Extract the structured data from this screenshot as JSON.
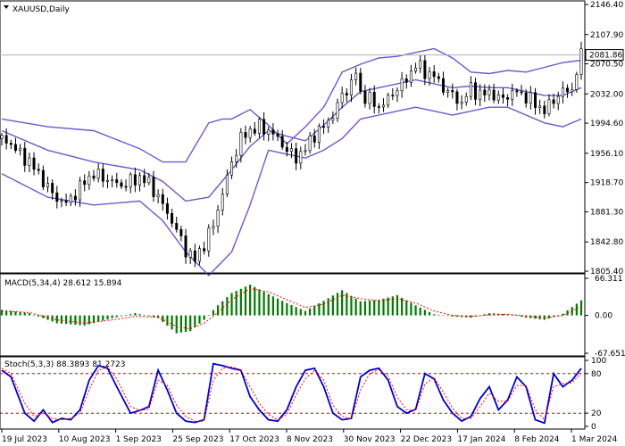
{
  "window": {
    "title": "XAUUSD,Daily",
    "menu_icon": "triangle-down-icon"
  },
  "chart_data": [
    {
      "type": "candlestick",
      "panel": "price",
      "symbol": "XAUUSD",
      "timeframe": "Daily",
      "current_price": "2081.86",
      "y_ticks": [
        "2146.40",
        "2107.90",
        "2070.50",
        "2032.00",
        "1994.60",
        "1956.10",
        "1918.70",
        "1881.30",
        "1842.80",
        "1805.40"
      ],
      "ylim": [
        1805.4,
        2146.4
      ],
      "x_ticks": [
        "19 Jul 2023",
        "10 Aug 2023",
        "1 Sep 2023",
        "25 Sep 2023",
        "17 Oct 2023",
        "8 Nov 2023",
        "30 Nov 2023",
        "22 Dec 2023",
        "17 Jan 2024",
        "8 Feb 2024",
        "1 Mar 2024"
      ],
      "overlay": "Bollinger Bands",
      "close_series": [
        [
          0,
          1975
        ],
        [
          4,
          1968
        ],
        [
          8,
          1955
        ],
        [
          12,
          1945
        ],
        [
          16,
          1930
        ],
        [
          20,
          1912
        ],
        [
          24,
          1898
        ],
        [
          28,
          1892
        ],
        [
          32,
          1905
        ],
        [
          36,
          1920
        ],
        [
          40,
          1930
        ],
        [
          44,
          1925
        ],
        [
          48,
          1920
        ],
        [
          52,
          1915
        ],
        [
          56,
          1920
        ],
        [
          60,
          1925
        ],
        [
          64,
          1918
        ],
        [
          68,
          1900
        ],
        [
          72,
          1880
        ],
        [
          76,
          1858
        ],
        [
          80,
          1832
        ],
        [
          84,
          1820
        ],
        [
          88,
          1840
        ],
        [
          92,
          1865
        ],
        [
          96,
          1905
        ],
        [
          100,
          1945
        ],
        [
          104,
          1975
        ],
        [
          108,
          1985
        ],
        [
          112,
          1990
        ],
        [
          116,
          1985
        ],
        [
          120,
          1975
        ],
        [
          124,
          1960
        ],
        [
          128,
          1950
        ],
        [
          132,
          1962
        ],
        [
          136,
          1980
        ],
        [
          140,
          1990
        ],
        [
          144,
          2005
        ],
        [
          148,
          2030
        ],
        [
          152,
          2045
        ],
        [
          154,
          2060
        ],
        [
          156,
          2032
        ],
        [
          160,
          2025
        ],
        [
          164,
          2015
        ],
        [
          168,
          2025
        ],
        [
          172,
          2040
        ],
        [
          176,
          2050
        ],
        [
          180,
          2070
        ],
        [
          184,
          2060
        ],
        [
          188,
          2055
        ],
        [
          192,
          2040
        ],
        [
          196,
          2030
        ],
        [
          200,
          2020
        ],
        [
          204,
          2040
        ],
        [
          208,
          2030
        ],
        [
          212,
          2035
        ],
        [
          216,
          2025
        ],
        [
          220,
          2030
        ],
        [
          224,
          2035
        ],
        [
          228,
          2028
        ],
        [
          232,
          2020
        ],
        [
          236,
          2010
        ],
        [
          240,
          2025
        ],
        [
          244,
          2035
        ],
        [
          248,
          2038
        ],
        [
          250,
          2060
        ],
        [
          252,
          2081
        ]
      ],
      "bollinger": {
        "upper": [
          [
            0,
            2000
          ],
          [
            20,
            1990
          ],
          [
            40,
            1985
          ],
          [
            60,
            1962
          ],
          [
            70,
            1945
          ],
          [
            80,
            1945
          ],
          [
            90,
            1995
          ],
          [
            96,
            2000
          ],
          [
            100,
            2000
          ],
          [
            108,
            2012
          ],
          [
            116,
            1992
          ],
          [
            124,
            1968
          ],
          [
            132,
            1990
          ],
          [
            140,
            2015
          ],
          [
            148,
            2060
          ],
          [
            156,
            2070
          ],
          [
            164,
            2078
          ],
          [
            172,
            2080
          ],
          [
            180,
            2085
          ],
          [
            188,
            2090
          ],
          [
            196,
            2078
          ],
          [
            204,
            2060
          ],
          [
            212,
            2058
          ],
          [
            220,
            2062
          ],
          [
            228,
            2060
          ],
          [
            236,
            2066
          ],
          [
            244,
            2072
          ],
          [
            252,
            2075
          ]
        ],
        "middle": [
          [
            0,
            1985
          ],
          [
            20,
            1960
          ],
          [
            40,
            1945
          ],
          [
            60,
            1935
          ],
          [
            70,
            1920
          ],
          [
            80,
            1895
          ],
          [
            90,
            1900
          ],
          [
            100,
            1935
          ],
          [
            108,
            1965
          ],
          [
            116,
            1985
          ],
          [
            124,
            1978
          ],
          [
            132,
            1972
          ],
          [
            140,
            1992
          ],
          [
            148,
            2015
          ],
          [
            156,
            2035
          ],
          [
            164,
            2040
          ],
          [
            172,
            2045
          ],
          [
            180,
            2050
          ],
          [
            188,
            2045
          ],
          [
            196,
            2040
          ],
          [
            204,
            2042
          ],
          [
            212,
            2040
          ],
          [
            220,
            2040
          ],
          [
            228,
            2035
          ],
          [
            236,
            2030
          ],
          [
            244,
            2030
          ],
          [
            252,
            2040
          ]
        ],
        "lower": [
          [
            0,
            1930
          ],
          [
            20,
            1900
          ],
          [
            40,
            1890
          ],
          [
            60,
            1895
          ],
          [
            70,
            1870
          ],
          [
            80,
            1830
          ],
          [
            90,
            1800
          ],
          [
            100,
            1830
          ],
          [
            108,
            1890
          ],
          [
            116,
            1960
          ],
          [
            124,
            1955
          ],
          [
            132,
            1950
          ],
          [
            140,
            1960
          ],
          [
            148,
            1975
          ],
          [
            156,
            2000
          ],
          [
            164,
            2005
          ],
          [
            172,
            2010
          ],
          [
            180,
            2015
          ],
          [
            188,
            2010
          ],
          [
            196,
            2005
          ],
          [
            204,
            2010
          ],
          [
            212,
            2015
          ],
          [
            220,
            2015
          ],
          [
            228,
            2005
          ],
          [
            236,
            1995
          ],
          [
            244,
            1990
          ],
          [
            252,
            2000
          ]
        ]
      }
    },
    {
      "type": "bar",
      "panel": "macd",
      "title": "MACD(5,34,4) 28.612 15.894",
      "y_ticks": [
        "66.311",
        "0.00",
        "-67.651"
      ],
      "ylim": [
        -67.651,
        66.311
      ],
      "histogram": [
        [
          0,
          10
        ],
        [
          12,
          4
        ],
        [
          24,
          -14
        ],
        [
          36,
          -18
        ],
        [
          48,
          -5
        ],
        [
          58,
          4
        ],
        [
          68,
          -5
        ],
        [
          76,
          -32
        ],
        [
          82,
          -28
        ],
        [
          88,
          -8
        ],
        [
          94,
          18
        ],
        [
          100,
          40
        ],
        [
          108,
          55
        ],
        [
          116,
          38
        ],
        [
          124,
          22
        ],
        [
          132,
          8
        ],
        [
          140,
          26
        ],
        [
          148,
          45
        ],
        [
          156,
          25
        ],
        [
          164,
          28
        ],
        [
          172,
          36
        ],
        [
          180,
          18
        ],
        [
          188,
          2
        ],
        [
          196,
          -2
        ],
        [
          204,
          -4
        ],
        [
          212,
          4
        ],
        [
          220,
          2
        ],
        [
          228,
          -4
        ],
        [
          236,
          -8
        ],
        [
          244,
          3
        ],
        [
          252,
          27
        ]
      ],
      "signal": [
        [
          0,
          8
        ],
        [
          12,
          5
        ],
        [
          24,
          -8
        ],
        [
          36,
          -14
        ],
        [
          48,
          -8
        ],
        [
          58,
          -2
        ],
        [
          68,
          -3
        ],
        [
          76,
          -20
        ],
        [
          82,
          -24
        ],
        [
          88,
          -14
        ],
        [
          94,
          5
        ],
        [
          100,
          28
        ],
        [
          108,
          48
        ],
        [
          116,
          42
        ],
        [
          124,
          28
        ],
        [
          132,
          14
        ],
        [
          140,
          20
        ],
        [
          148,
          36
        ],
        [
          156,
          30
        ],
        [
          164,
          26
        ],
        [
          172,
          30
        ],
        [
          180,
          22
        ],
        [
          188,
          8
        ],
        [
          196,
          0
        ],
        [
          204,
          -2
        ],
        [
          212,
          1
        ],
        [
          220,
          2
        ],
        [
          228,
          -1
        ],
        [
          236,
          -5
        ],
        [
          244,
          0
        ],
        [
          252,
          16
        ]
      ]
    },
    {
      "type": "line",
      "panel": "stochastic",
      "title": "Stoch(5,3,3) 88.3893 81.2723",
      "y_ticks": [
        "100",
        "80",
        "20",
        "0"
      ],
      "ylim": [
        0,
        100
      ],
      "levels": [
        80,
        20
      ],
      "main": [
        [
          0,
          85
        ],
        [
          4,
          75
        ],
        [
          10,
          20
        ],
        [
          14,
          8
        ],
        [
          18,
          25
        ],
        [
          22,
          6
        ],
        [
          26,
          12
        ],
        [
          30,
          10
        ],
        [
          34,
          25
        ],
        [
          38,
          70
        ],
        [
          42,
          92
        ],
        [
          46,
          88
        ],
        [
          50,
          60
        ],
        [
          56,
          20
        ],
        [
          60,
          24
        ],
        [
          64,
          30
        ],
        [
          68,
          85
        ],
        [
          72,
          55
        ],
        [
          76,
          20
        ],
        [
          80,
          8
        ],
        [
          84,
          6
        ],
        [
          88,
          10
        ],
        [
          92,
          95
        ],
        [
          96,
          92
        ],
        [
          100,
          88
        ],
        [
          104,
          85
        ],
        [
          108,
          45
        ],
        [
          112,
          25
        ],
        [
          116,
          10
        ],
        [
          120,
          8
        ],
        [
          124,
          25
        ],
        [
          128,
          60
        ],
        [
          132,
          85
        ],
        [
          136,
          88
        ],
        [
          140,
          60
        ],
        [
          144,
          20
        ],
        [
          148,
          10
        ],
        [
          152,
          12
        ],
        [
          156,
          75
        ],
        [
          160,
          85
        ],
        [
          164,
          88
        ],
        [
          168,
          70
        ],
        [
          172,
          30
        ],
        [
          176,
          20
        ],
        [
          180,
          26
        ],
        [
          184,
          80
        ],
        [
          188,
          72
        ],
        [
          192,
          40
        ],
        [
          196,
          20
        ],
        [
          200,
          8
        ],
        [
          204,
          15
        ],
        [
          208,
          42
        ],
        [
          212,
          60
        ],
        [
          216,
          25
        ],
        [
          220,
          40
        ],
        [
          224,
          75
        ],
        [
          228,
          60
        ],
        [
          232,
          10
        ],
        [
          236,
          5
        ],
        [
          240,
          80
        ],
        [
          244,
          60
        ],
        [
          248,
          70
        ],
        [
          252,
          88
        ]
      ],
      "signal": [
        [
          0,
          88
        ],
        [
          4,
          80
        ],
        [
          10,
          35
        ],
        [
          14,
          15
        ],
        [
          18,
          20
        ],
        [
          22,
          12
        ],
        [
          26,
          10
        ],
        [
          30,
          12
        ],
        [
          34,
          20
        ],
        [
          38,
          55
        ],
        [
          42,
          85
        ],
        [
          46,
          90
        ],
        [
          50,
          72
        ],
        [
          56,
          30
        ],
        [
          60,
          24
        ],
        [
          64,
          26
        ],
        [
          68,
          70
        ],
        [
          72,
          62
        ],
        [
          76,
          32
        ],
        [
          80,
          15
        ],
        [
          84,
          8
        ],
        [
          88,
          8
        ],
        [
          92,
          70
        ],
        [
          96,
          88
        ],
        [
          100,
          90
        ],
        [
          104,
          86
        ],
        [
          108,
          60
        ],
        [
          112,
          35
        ],
        [
          116,
          18
        ],
        [
          120,
          10
        ],
        [
          124,
          18
        ],
        [
          128,
          48
        ],
        [
          132,
          72
        ],
        [
          136,
          85
        ],
        [
          140,
          70
        ],
        [
          144,
          32
        ],
        [
          148,
          15
        ],
        [
          152,
          11
        ],
        [
          156,
          55
        ],
        [
          160,
          80
        ],
        [
          164,
          86
        ],
        [
          168,
          76
        ],
        [
          172,
          44
        ],
        [
          176,
          25
        ],
        [
          180,
          24
        ],
        [
          184,
          64
        ],
        [
          188,
          74
        ],
        [
          192,
          52
        ],
        [
          196,
          28
        ],
        [
          200,
          12
        ],
        [
          204,
          12
        ],
        [
          208,
          30
        ],
        [
          212,
          50
        ],
        [
          216,
          38
        ],
        [
          220,
          38
        ],
        [
          224,
          62
        ],
        [
          228,
          62
        ],
        [
          232,
          25
        ],
        [
          236,
          10
        ],
        [
          240,
          60
        ],
        [
          244,
          65
        ],
        [
          248,
          66
        ],
        [
          252,
          81
        ]
      ]
    }
  ]
}
